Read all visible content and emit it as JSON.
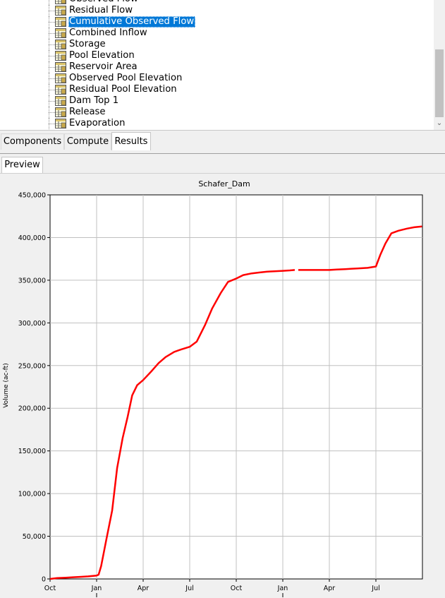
{
  "tree": {
    "items": [
      {
        "label": "Observed Flow",
        "selected": false
      },
      {
        "label": "Residual Flow",
        "selected": false
      },
      {
        "label": "Cumulative Observed Flow",
        "selected": true
      },
      {
        "label": "Combined Inflow",
        "selected": false
      },
      {
        "label": "Storage",
        "selected": false
      },
      {
        "label": "Pool Elevation",
        "selected": false
      },
      {
        "label": "Reservoir Area",
        "selected": false
      },
      {
        "label": "Observed Pool Elevation",
        "selected": false
      },
      {
        "label": "Residual Pool Elevation",
        "selected": false
      },
      {
        "label": "Dam Top 1",
        "selected": false
      },
      {
        "label": "Release",
        "selected": false
      },
      {
        "label": "Evaporation",
        "selected": false
      }
    ],
    "icon": "table-icon"
  },
  "tabs": {
    "components": "Components",
    "compute": "Compute",
    "results": "Results",
    "active": "results"
  },
  "preview": {
    "tab_label": "Preview"
  },
  "chart_data": {
    "type": "line",
    "title": "Schafer_Dam",
    "ylabel": "Volume (ac-ft)",
    "xlabel": "",
    "ylim": [
      0,
      450000
    ],
    "y_ticks": [
      "0",
      "50,000",
      "100,000",
      "150,000",
      "200,000",
      "250,000",
      "300,000",
      "350,000",
      "400,000",
      "450,000"
    ],
    "x_ticks": [
      "Oct",
      "Jan",
      "Apr",
      "Jul",
      "Oct",
      "Jan",
      "Apr",
      "Jul"
    ],
    "grid": true,
    "line_color": "#ff0000",
    "series": [
      {
        "name": "",
        "segments": [
          [
            [
              "Oct 1",
              0
            ],
            [
              "Oct 15",
              1000
            ],
            [
              "Nov 1",
              1500
            ],
            [
              "Nov 15",
              2000
            ],
            [
              "Dec 1",
              2500
            ],
            [
              "Dec 15",
              3000
            ],
            [
              "Jan 1",
              4000
            ],
            [
              "Jan 5",
              5000
            ],
            [
              "Jan 10",
              15000
            ],
            [
              "Jan 20",
              45000
            ],
            [
              "Feb 1",
              80000
            ],
            [
              "Feb 10",
              130000
            ],
            [
              "Feb 20",
              165000
            ],
            [
              "Mar 1",
              190000
            ],
            [
              "Mar 10",
              215000
            ],
            [
              "Mar 20",
              227000
            ],
            [
              "Apr 1",
              233000
            ],
            [
              "Apr 15",
              242000
            ],
            [
              "May 1",
              253000
            ],
            [
              "May 15",
              260000
            ],
            [
              "Jun 1",
              266000
            ],
            [
              "Jun 15",
              269000
            ],
            [
              "Jul 1",
              272000
            ],
            [
              "Jul 15",
              278000
            ],
            [
              "Aug 1",
              298000
            ],
            [
              "Aug 15",
              317000
            ],
            [
              "Sep 1",
              335000
            ],
            [
              "Sep 15",
              348000
            ],
            [
              "Oct 1",
              352000
            ],
            [
              "Oct 15",
              356000
            ],
            [
              "Nov 1",
              358000
            ],
            [
              "Nov 15",
              359000
            ],
            [
              "Dec 1",
              360000
            ],
            [
              "Dec 15",
              360500
            ],
            [
              "Jan 1",
              361000
            ],
            [
              "Jan 15",
              361500
            ],
            [
              "Jan 25",
              362000
            ]
          ],
          [
            [
              "Feb 1",
              362000
            ],
            [
              "Feb 15",
              362000
            ],
            [
              "Mar 1",
              362000
            ],
            [
              "Mar 15",
              362000
            ],
            [
              "Apr 1",
              362000
            ],
            [
              "Apr 15",
              362500
            ],
            [
              "May 1",
              363000
            ],
            [
              "May 15",
              363500
            ],
            [
              "Jun 1",
              364000
            ],
            [
              "Jun 15",
              364500
            ],
            [
              "Jul 1",
              366000
            ],
            [
              "Jul 10",
              380000
            ],
            [
              "Jul 20",
              393000
            ],
            [
              "Aug 1",
              405000
            ],
            [
              "Aug 15",
              408000
            ],
            [
              "Sep 1",
              410500
            ],
            [
              "Sep 15",
              412000
            ],
            [
              "Sep 30",
              413000
            ]
          ]
        ]
      }
    ]
  }
}
